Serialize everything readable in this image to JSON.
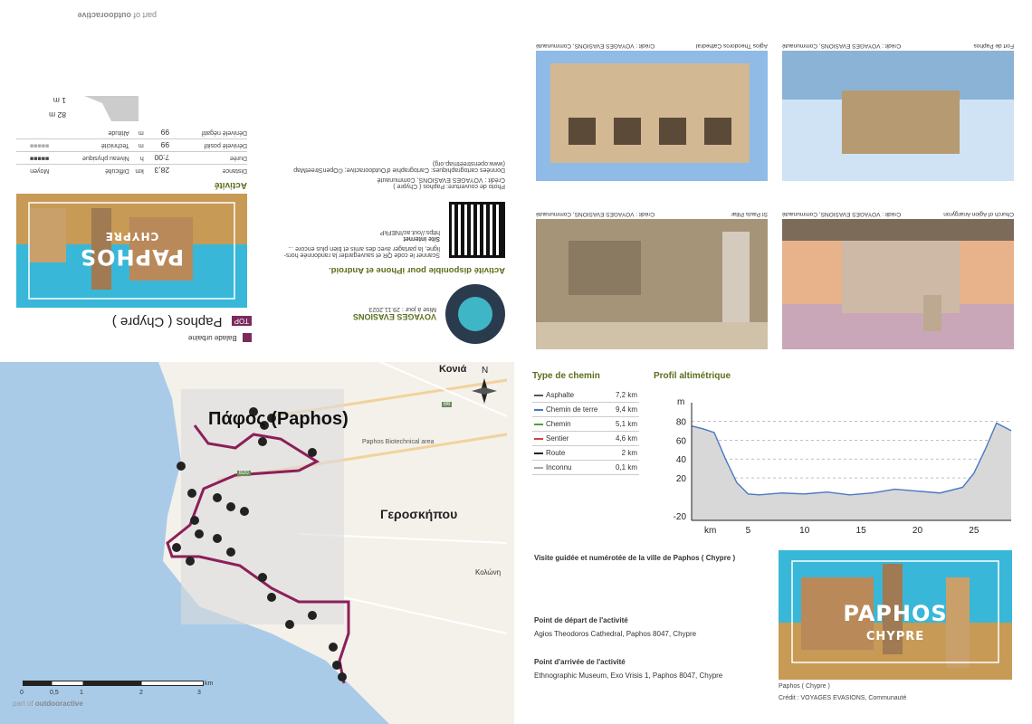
{
  "brand": {
    "part_of": "part of",
    "name": "outdooractive"
  },
  "flyer": {
    "category": "Balade urbaine",
    "top_badge": "TOP",
    "title": "Paphos ( Chypre )",
    "cover_title": "PAPHOS",
    "cover_subtitle": "CHYPRE",
    "author": "VOYAGES EVASIONS",
    "updated": "Mise à jour : 29.11.2023",
    "app_note": "Activité disponible pour iPhone et Android.",
    "qr_text": "Scanner le code QR et sauvegarder la randonnée hors-ligne, la partager avec des amis et bien plus encore ...",
    "website_label": "Site internet",
    "website_url": "https://out.ac/INEFkP",
    "photo_credit": "Photo de couverture: Paphos ( Chypre )",
    "photo_credit2": "Crédit : VOYAGES EVASIONS, Communauté",
    "map_data": "Données cartographiques: Cartographie d'Outdooractive; ©OpenStreetMap (www.openstreetmap.org)"
  },
  "activity": {
    "heading": "Activité",
    "rows": [
      {
        "label": "Distance",
        "value": "28,3",
        "unit": "km",
        "label2": "Difficulté",
        "value2": "Moyen"
      },
      {
        "label": "Durée",
        "value": "7:00",
        "unit": "h",
        "label2": "Niveau physique",
        "value2": ""
      },
      {
        "label": "Dénivelé positif",
        "value": "99",
        "unit": "m",
        "label2": "Technicité",
        "value2": ""
      },
      {
        "label": "Dénivelé négatif",
        "value": "99",
        "unit": "m",
        "label2": "Altitude",
        "value2": ""
      }
    ],
    "alt_max": "82 m",
    "alt_min": "1 m"
  },
  "photos": [
    {
      "caption": "Fort de Paphos",
      "credit": "Crédit : VOYAGES EVASIONS, Communauté"
    },
    {
      "caption": "Agios Theodoros Cathedral",
      "credit": "Crédit : VOYAGES EVASIONS, Communauté"
    },
    {
      "caption": "Church of Agion Anargyron",
      "credit": "Crédit : VOYAGES EVASIONS, Communauté"
    },
    {
      "caption": "St Pauls Pillar",
      "credit": "Crédit : VOYAGES EVASIONS, Communauté"
    }
  ],
  "map": {
    "city": "Πάφος (Paphos)",
    "town2": "Γεροσκήπου",
    "town3": "Κονιά",
    "town4": "Κολώνη",
    "district": "Paphos Biotechnical area",
    "road": "B20",
    "road2": "B6",
    "north": "N",
    "scale_labels": [
      "0",
      "0,5",
      "1",
      "2",
      "3"
    ],
    "scale_unit": "km"
  },
  "path_types": {
    "heading": "Type de chemin",
    "rows": [
      {
        "name": "Asphalte",
        "value": "7,2 km",
        "color": "#555555"
      },
      {
        "name": "Chemin de terre",
        "value": "9,4 km",
        "color": "#4a78c2"
      },
      {
        "name": "Chemin",
        "value": "5,1 km",
        "color": "#4aa33a"
      },
      {
        "name": "Sentier",
        "value": "4,6 km",
        "color": "#d64040"
      },
      {
        "name": "Route",
        "value": "2 km",
        "color": "#222222"
      },
      {
        "name": "Inconnu",
        "value": "0,1 km",
        "color": "#aaaaaa"
      }
    ]
  },
  "profile": {
    "heading": "Profil altimétrique"
  },
  "chart_data": {
    "type": "area",
    "title": "Profil altimétrique",
    "xlabel": "km",
    "ylabel": "m",
    "x": [
      0,
      1,
      2,
      3,
      4,
      5,
      6,
      8,
      10,
      12,
      14,
      16,
      18,
      20,
      22,
      24,
      25,
      26,
      27,
      28.3
    ],
    "y": [
      75,
      72,
      68,
      40,
      15,
      3,
      2,
      4,
      3,
      5,
      2,
      4,
      8,
      6,
      4,
      10,
      25,
      50,
      78,
      70
    ],
    "xticks": [
      5,
      10,
      15,
      20,
      25
    ],
    "yticks": [
      -20,
      20,
      40,
      60,
      80
    ],
    "xlim": [
      0,
      28.3
    ],
    "ylim": [
      -25,
      90
    ]
  },
  "description": {
    "summary": "Visite guidée et numérotée de la ville de Paphos ( Chypre )",
    "start_label": "Point de départ de l'activité",
    "start_value": "Agios Theodoros Cathedral, Paphos 8047, Chypre",
    "end_label": "Point d'arrivée de l'activité",
    "end_value": "Ethnographic Museum, Exo Vrisis 1, Paphos 8047, Chypre",
    "photo_caption": "Paphos ( Chypre )",
    "photo_credit": "Crédit : VOYAGES EVASIONS, Communauté"
  }
}
